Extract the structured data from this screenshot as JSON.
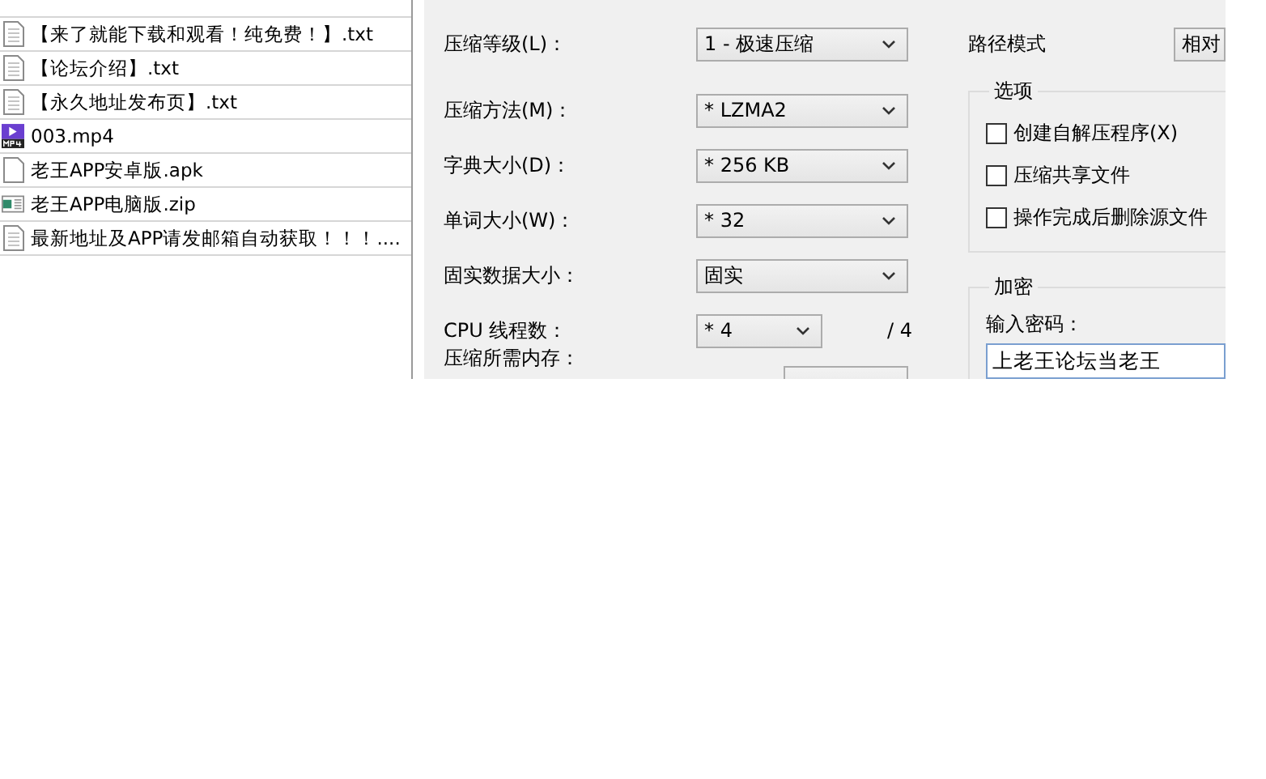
{
  "file_list": [
    {
      "name": "【来了就能下载和观看！纯免费！】.txt",
      "kind": "text"
    },
    {
      "name": "【论坛介绍】.txt",
      "kind": "text"
    },
    {
      "name": "【永久地址发布页】.txt",
      "kind": "text"
    },
    {
      "name": "003.mp4",
      "kind": "video"
    },
    {
      "name": "老王APP安卓版.apk",
      "kind": "blank"
    },
    {
      "name": "老王APP电脑版.zip",
      "kind": "archive"
    },
    {
      "name": "最新地址及APP请发邮箱自动获取！！！....",
      "kind": "text"
    }
  ],
  "compression": {
    "fields": [
      {
        "label": "压缩等级(L)：",
        "value": "1 - 极速压缩"
      },
      {
        "label": "压缩方法(M)：",
        "value": "* LZMA2"
      },
      {
        "label": "字典大小(D)：",
        "value": "* 256 KB"
      },
      {
        "label": "单词大小(W)：",
        "value": "* 32"
      },
      {
        "label": "固实数据大小：",
        "value": "固实"
      }
    ],
    "cpu_threads": {
      "label": "CPU 线程数：",
      "value": "* 4",
      "max": "/ 4"
    },
    "memory": {
      "label": "压缩所需内存："
    }
  },
  "path_mode": {
    "label": "路径模式",
    "value": "相对"
  },
  "options": {
    "title": "选项",
    "items": [
      {
        "label": "创建自解压程序(X)",
        "checked": false
      },
      {
        "label": "压缩共享文件",
        "checked": false
      },
      {
        "label": "操作完成后删除源文件",
        "checked": false
      }
    ]
  },
  "encryption": {
    "title": "加密",
    "password_label": "输入密码：",
    "password": "上老王论坛当老王"
  }
}
